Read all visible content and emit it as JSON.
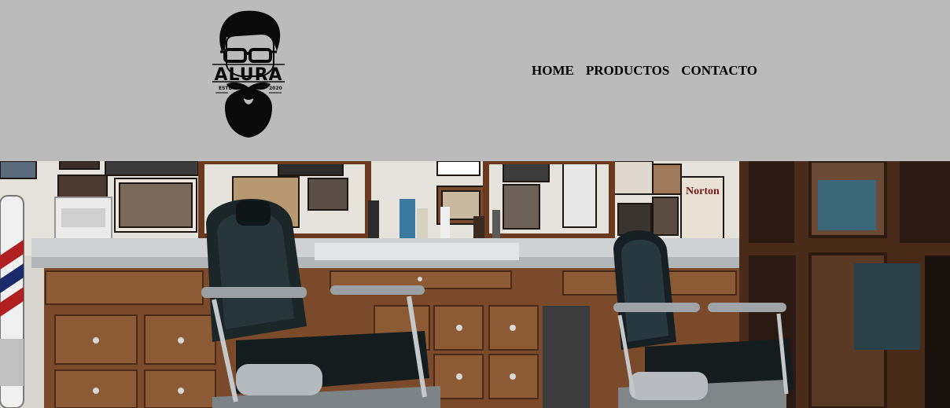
{
  "logo": {
    "brand": "ALURA",
    "left_label": "ESTD",
    "right_label": "2020"
  },
  "nav": {
    "items": [
      {
        "label": "HOME"
      },
      {
        "label": "PRODUCTOS"
      },
      {
        "label": "CONTACTO"
      }
    ]
  },
  "banner": {
    "sign_text": "Norton"
  },
  "colors": {
    "header_bg": "#bbbbbb",
    "nav_text": "#000000"
  }
}
